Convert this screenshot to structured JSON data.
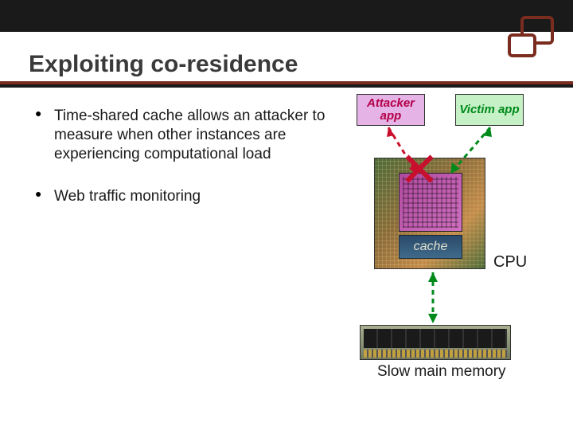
{
  "title": "Exploiting co-residence",
  "bullets": [
    "Time-shared cache allows an attacker to measure when other instances are experiencing computational load",
    "Web traffic monitoring"
  ],
  "diagram": {
    "attacker_label": "Attacker app",
    "victim_label": "Victim app",
    "cache_label": "cache",
    "cpu_label": "CPU",
    "memory_label": "Slow main memory"
  }
}
